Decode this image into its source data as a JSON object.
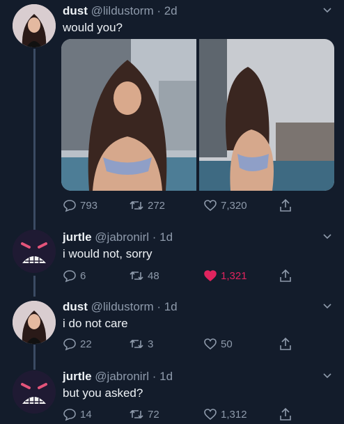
{
  "tweets": [
    {
      "display_name": "dust",
      "handle_meta": "@lildustorm · 2d",
      "text": "would you?",
      "avatar": "portrait-photo",
      "replies": "793",
      "retweets": "272",
      "likes": "7,320",
      "liked": false
    },
    {
      "display_name": "jurtle",
      "handle_meta": "@jabronirl · 1d",
      "text": "i would not, sorry",
      "avatar": "angry-face-icon",
      "replies": "6",
      "retweets": "48",
      "likes": "1,321",
      "liked": true
    },
    {
      "display_name": "dust",
      "handle_meta": "@lildustorm · 1d",
      "text": "i do not care",
      "avatar": "portrait-photo",
      "replies": "22",
      "retweets": "3",
      "likes": "50",
      "liked": false
    },
    {
      "display_name": "jurtle",
      "handle_meta": "@jabronirl · 1d",
      "text": "but you asked?",
      "avatar": "angry-face-icon",
      "replies": "14",
      "retweets": "72",
      "likes": "1,312",
      "liked": false
    }
  ],
  "icons": {
    "reply": "reply-bubble-icon",
    "retweet": "retweet-icon",
    "like": "heart-icon",
    "share": "share-icon",
    "menu": "chevron-down-icon"
  },
  "colors": {
    "background": "#131c2b",
    "like_active": "#e0245e",
    "muted": "#8e9aab"
  }
}
